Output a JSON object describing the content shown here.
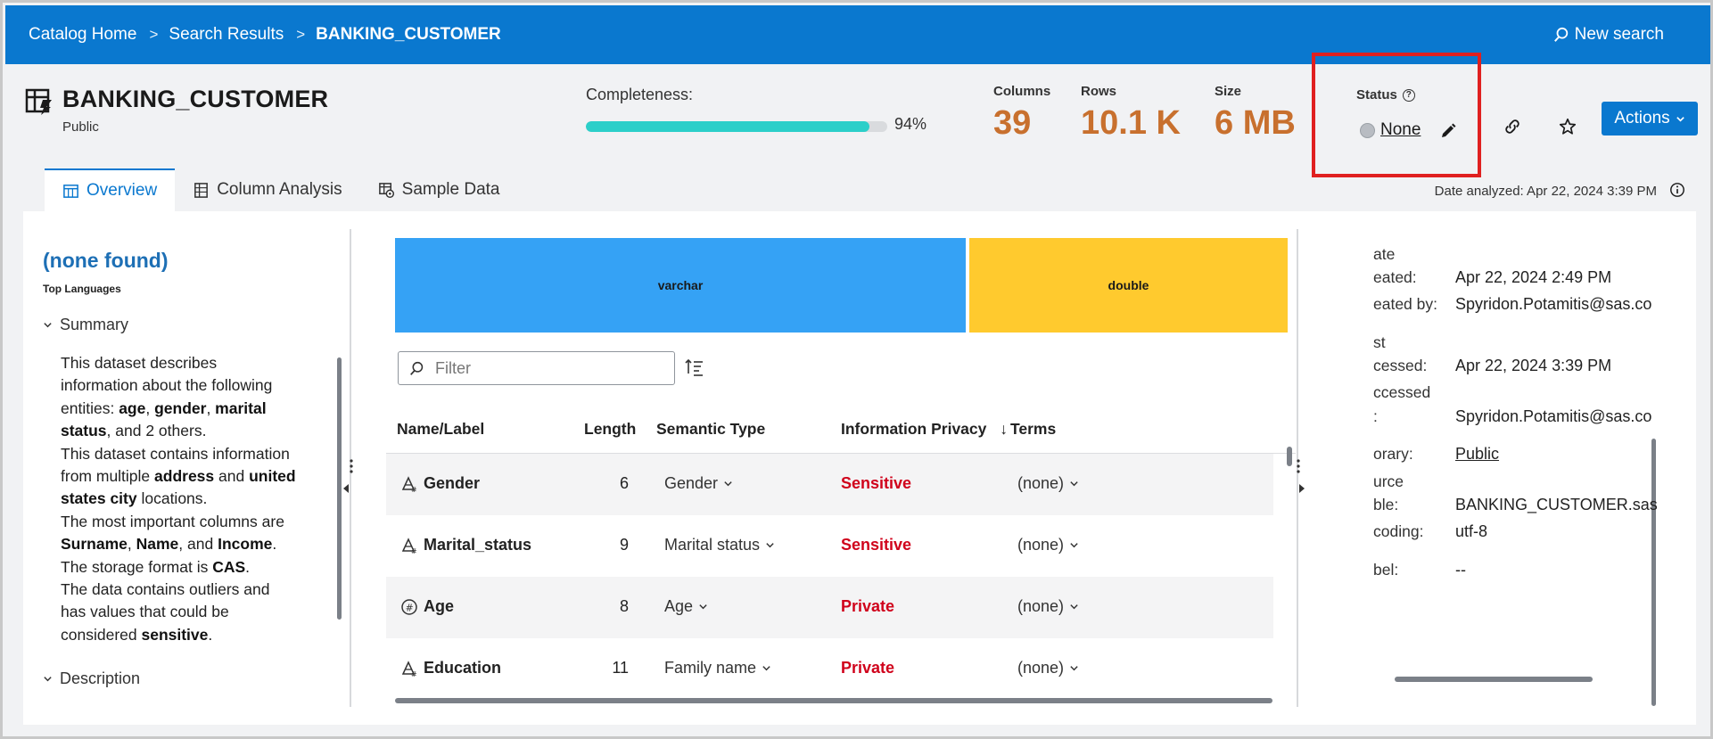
{
  "breadcrumb": {
    "items": [
      "Catalog Home",
      "Search Results"
    ],
    "current": "BANKING_CUSTOMER",
    "separator": ">"
  },
  "topbar": {
    "new_search_label": "New search"
  },
  "dataset": {
    "title": "BANKING_CUSTOMER",
    "library": "Public",
    "completeness_label": "Completeness:",
    "completeness_value": "94%",
    "completeness_fraction": 0.94
  },
  "stats": [
    {
      "label": "Columns",
      "value": "39"
    },
    {
      "label": "Rows",
      "value": "10.1 K"
    },
    {
      "label": "Size",
      "value": "6 MB"
    }
  ],
  "status": {
    "label": "Status",
    "value": "None"
  },
  "actions": {
    "label": "Actions"
  },
  "tabs": [
    {
      "label": "Overview",
      "icon": "table-icon",
      "active": true
    },
    {
      "label": "Column Analysis",
      "icon": "columns-icon",
      "active": false
    },
    {
      "label": "Sample Data",
      "icon": "sample-data-icon",
      "active": false
    }
  ],
  "date_analyzed": "Date analyzed: Apr 22, 2024 3:39 PM",
  "left_panel": {
    "languages_value": "(none found)",
    "languages_label": "Top Languages",
    "summary_heading": "Summary",
    "description_heading": "Description",
    "summary_lines": [
      [
        {
          "t": "This dataset describes"
        }
      ],
      [
        {
          "t": "information about the following"
        }
      ],
      [
        {
          "t": "entities: "
        },
        {
          "t": "age",
          "b": true
        },
        {
          "t": ", "
        },
        {
          "t": "gender",
          "b": true
        },
        {
          "t": ", "
        },
        {
          "t": "marital",
          "b": true
        }
      ],
      [
        {
          "t": "status",
          "b": true
        },
        {
          "t": ", and 2 others."
        }
      ],
      [
        {
          "t": "This dataset contains information"
        }
      ],
      [
        {
          "t": "from multiple "
        },
        {
          "t": "address",
          "b": true
        },
        {
          "t": " and "
        },
        {
          "t": "united",
          "b": true
        }
      ],
      [
        {
          "t": "states city",
          "b": true
        },
        {
          "t": " locations."
        }
      ],
      [
        {
          "t": "The most important columns are"
        }
      ],
      [
        {
          "t": "Surname",
          "b": true
        },
        {
          "t": ", "
        },
        {
          "t": "Name",
          "b": true
        },
        {
          "t": ", and "
        },
        {
          "t": "Income",
          "b": true
        },
        {
          "t": "."
        }
      ],
      [
        {
          "t": "The storage format is "
        },
        {
          "t": "CAS",
          "b": true
        },
        {
          "t": "."
        }
      ],
      [
        {
          "t": "The data contains outliers and"
        }
      ],
      [
        {
          "t": "has values that could be"
        }
      ],
      [
        {
          "t": "considered "
        },
        {
          "t": "sensitive",
          "b": true
        },
        {
          "t": "."
        }
      ]
    ]
  },
  "type_bars": [
    {
      "label": "varchar",
      "color": "#35a2f5"
    },
    {
      "label": "double",
      "color": "#ffca2e"
    }
  ],
  "filter": {
    "placeholder": "Filter"
  },
  "table": {
    "headers": [
      "Name/Label",
      "Length",
      "Semantic Type",
      "Information Privacy",
      "Terms"
    ],
    "sort_indicator": "↓",
    "rows": [
      {
        "icon": "text-type-icon",
        "name": "Gender",
        "length": "6",
        "semantic": "Gender",
        "privacy": "Sensitive",
        "terms": "(none)"
      },
      {
        "icon": "text-type-icon",
        "name": "Marital_status",
        "length": "9",
        "semantic": "Marital status",
        "privacy": "Sensitive",
        "terms": "(none)"
      },
      {
        "icon": "numeric-type-icon",
        "name": "Age",
        "length": "8",
        "semantic": "Age",
        "privacy": "Private",
        "terms": "(none)"
      },
      {
        "icon": "text-type-icon",
        "name": "Education",
        "length": "11",
        "semantic": "Family name",
        "privacy": "Private",
        "terms": "(none)"
      }
    ]
  },
  "right_panel": {
    "items": [
      {
        "k": "ate",
        "v": ""
      },
      {
        "k": "eated:",
        "v": "Apr 22, 2024 2:49 PM"
      },
      {
        "k": "eated by:",
        "v": "Spyridon.Potamitis@sas.co"
      },
      {
        "k": "st",
        "v": ""
      },
      {
        "k": "cessed:",
        "v": "Apr 22, 2024 3:39 PM"
      },
      {
        "k": "ccessed",
        "v": ""
      },
      {
        "k": ":",
        "v": "Spyridon.Potamitis@sas.co"
      },
      {
        "k": "orary:",
        "v": "Public",
        "link": true
      },
      {
        "k": "urce",
        "v": ""
      },
      {
        "k": "ble:",
        "v": "BANKING_CUSTOMER.sas"
      },
      {
        "k": "coding:",
        "v": "utf-8"
      },
      {
        "k": "bel:",
        "v": "--"
      }
    ]
  },
  "colors": {
    "brand": "#0a78cf",
    "stat_value": "#c8702e",
    "progress": "#2ccfc9",
    "privacy": "#d0021b",
    "highlight_box": "#e02020",
    "link_heading": "#1d6fb5"
  }
}
